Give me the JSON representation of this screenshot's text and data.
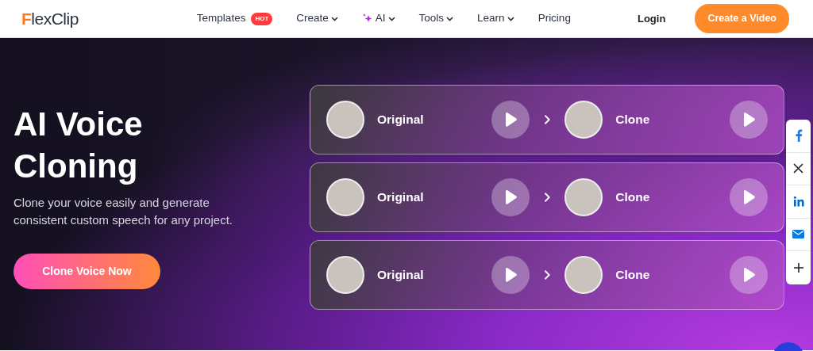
{
  "brand": {
    "name": "FlexClip"
  },
  "nav": [
    {
      "label": "Templates",
      "kind": "link",
      "badge": "HOT"
    },
    {
      "label": "Create",
      "kind": "dropdown"
    },
    {
      "label": "AI",
      "kind": "ai-dropdown"
    },
    {
      "label": "Tools",
      "kind": "dropdown"
    },
    {
      "label": "Learn",
      "kind": "dropdown"
    },
    {
      "label": "Pricing",
      "kind": "link"
    }
  ],
  "login": "Login",
  "cta": "Create a Video",
  "hero": {
    "title": "AI Voice Cloning",
    "subtitle": "Clone your voice easily and generate consistent custom speech for any project.",
    "button": "Clone Voice Now"
  },
  "voices": [
    {
      "original": "Original",
      "clone": "Clone"
    },
    {
      "original": "Original",
      "clone": "Clone"
    },
    {
      "original": "Original",
      "clone": "Clone"
    }
  ]
}
